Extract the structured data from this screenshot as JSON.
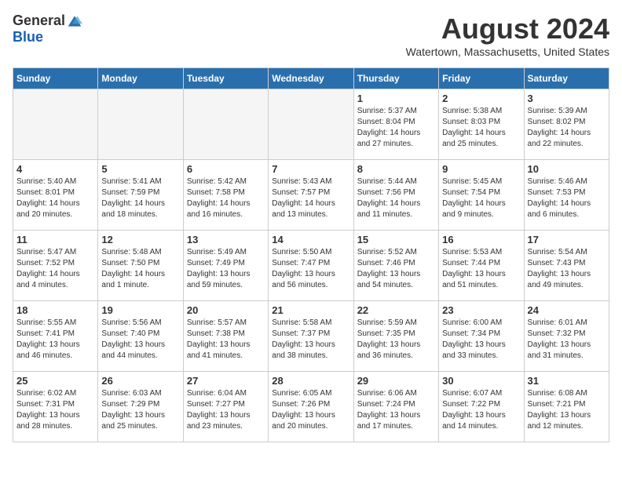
{
  "header": {
    "logo_general": "General",
    "logo_blue": "Blue",
    "month_year": "August 2024",
    "location": "Watertown, Massachusetts, United States"
  },
  "calendar": {
    "weekdays": [
      "Sunday",
      "Monday",
      "Tuesday",
      "Wednesday",
      "Thursday",
      "Friday",
      "Saturday"
    ],
    "weeks": [
      [
        {
          "day": "",
          "empty": true
        },
        {
          "day": "",
          "empty": true
        },
        {
          "day": "",
          "empty": true
        },
        {
          "day": "",
          "empty": true
        },
        {
          "day": "1",
          "sunrise": "5:37 AM",
          "sunset": "8:04 PM",
          "daylight": "14 hours and 27 minutes."
        },
        {
          "day": "2",
          "sunrise": "5:38 AM",
          "sunset": "8:03 PM",
          "daylight": "14 hours and 25 minutes."
        },
        {
          "day": "3",
          "sunrise": "5:39 AM",
          "sunset": "8:02 PM",
          "daylight": "14 hours and 22 minutes."
        }
      ],
      [
        {
          "day": "4",
          "sunrise": "5:40 AM",
          "sunset": "8:01 PM",
          "daylight": "14 hours and 20 minutes."
        },
        {
          "day": "5",
          "sunrise": "5:41 AM",
          "sunset": "7:59 PM",
          "daylight": "14 hours and 18 minutes."
        },
        {
          "day": "6",
          "sunrise": "5:42 AM",
          "sunset": "7:58 PM",
          "daylight": "14 hours and 16 minutes."
        },
        {
          "day": "7",
          "sunrise": "5:43 AM",
          "sunset": "7:57 PM",
          "daylight": "14 hours and 13 minutes."
        },
        {
          "day": "8",
          "sunrise": "5:44 AM",
          "sunset": "7:56 PM",
          "daylight": "14 hours and 11 minutes."
        },
        {
          "day": "9",
          "sunrise": "5:45 AM",
          "sunset": "7:54 PM",
          "daylight": "14 hours and 9 minutes."
        },
        {
          "day": "10",
          "sunrise": "5:46 AM",
          "sunset": "7:53 PM",
          "daylight": "14 hours and 6 minutes."
        }
      ],
      [
        {
          "day": "11",
          "sunrise": "5:47 AM",
          "sunset": "7:52 PM",
          "daylight": "14 hours and 4 minutes."
        },
        {
          "day": "12",
          "sunrise": "5:48 AM",
          "sunset": "7:50 PM",
          "daylight": "14 hours and 1 minute."
        },
        {
          "day": "13",
          "sunrise": "5:49 AM",
          "sunset": "7:49 PM",
          "daylight": "13 hours and 59 minutes."
        },
        {
          "day": "14",
          "sunrise": "5:50 AM",
          "sunset": "7:47 PM",
          "daylight": "13 hours and 56 minutes."
        },
        {
          "day": "15",
          "sunrise": "5:52 AM",
          "sunset": "7:46 PM",
          "daylight": "13 hours and 54 minutes."
        },
        {
          "day": "16",
          "sunrise": "5:53 AM",
          "sunset": "7:44 PM",
          "daylight": "13 hours and 51 minutes."
        },
        {
          "day": "17",
          "sunrise": "5:54 AM",
          "sunset": "7:43 PM",
          "daylight": "13 hours and 49 minutes."
        }
      ],
      [
        {
          "day": "18",
          "sunrise": "5:55 AM",
          "sunset": "7:41 PM",
          "daylight": "13 hours and 46 minutes."
        },
        {
          "day": "19",
          "sunrise": "5:56 AM",
          "sunset": "7:40 PM",
          "daylight": "13 hours and 44 minutes."
        },
        {
          "day": "20",
          "sunrise": "5:57 AM",
          "sunset": "7:38 PM",
          "daylight": "13 hours and 41 minutes."
        },
        {
          "day": "21",
          "sunrise": "5:58 AM",
          "sunset": "7:37 PM",
          "daylight": "13 hours and 38 minutes."
        },
        {
          "day": "22",
          "sunrise": "5:59 AM",
          "sunset": "7:35 PM",
          "daylight": "13 hours and 36 minutes."
        },
        {
          "day": "23",
          "sunrise": "6:00 AM",
          "sunset": "7:34 PM",
          "daylight": "13 hours and 33 minutes."
        },
        {
          "day": "24",
          "sunrise": "6:01 AM",
          "sunset": "7:32 PM",
          "daylight": "13 hours and 31 minutes."
        }
      ],
      [
        {
          "day": "25",
          "sunrise": "6:02 AM",
          "sunset": "7:31 PM",
          "daylight": "13 hours and 28 minutes."
        },
        {
          "day": "26",
          "sunrise": "6:03 AM",
          "sunset": "7:29 PM",
          "daylight": "13 hours and 25 minutes."
        },
        {
          "day": "27",
          "sunrise": "6:04 AM",
          "sunset": "7:27 PM",
          "daylight": "13 hours and 23 minutes."
        },
        {
          "day": "28",
          "sunrise": "6:05 AM",
          "sunset": "7:26 PM",
          "daylight": "13 hours and 20 minutes."
        },
        {
          "day": "29",
          "sunrise": "6:06 AM",
          "sunset": "7:24 PM",
          "daylight": "13 hours and 17 minutes."
        },
        {
          "day": "30",
          "sunrise": "6:07 AM",
          "sunset": "7:22 PM",
          "daylight": "13 hours and 14 minutes."
        },
        {
          "day": "31",
          "sunrise": "6:08 AM",
          "sunset": "7:21 PM",
          "daylight": "13 hours and 12 minutes."
        }
      ]
    ]
  },
  "labels": {
    "sunrise": "Sunrise:",
    "sunset": "Sunset:",
    "daylight": "Daylight:"
  }
}
